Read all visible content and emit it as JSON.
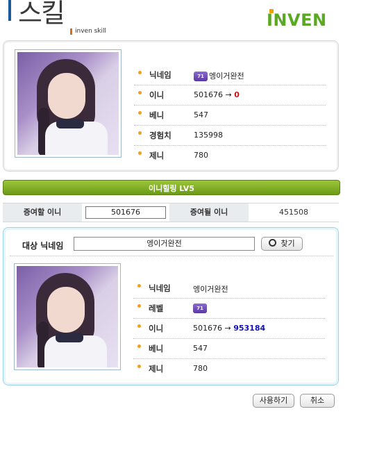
{
  "header": {
    "title": "스킬",
    "subtitle": "inven skill",
    "logo": "INVEN"
  },
  "my_profile": {
    "rows": [
      {
        "label": "닉네임",
        "value": "엥이거완전",
        "badge": "71"
      },
      {
        "label": "이니",
        "value": "501676 →",
        "value_extra": "0"
      },
      {
        "label": "베니",
        "value": "547"
      },
      {
        "label": "경험치",
        "value": "135998"
      },
      {
        "label": "제니",
        "value": "780"
      }
    ]
  },
  "skill_bar": {
    "title": "이니힐링 LV5"
  },
  "gift": {
    "give_label": "증여할 이니",
    "give_value": "501676",
    "receive_label": "증여될 이니",
    "receive_value": "451508"
  },
  "target": {
    "label": "대상 닉네임",
    "input_value": "엥이거완전",
    "search_label": "찾기",
    "rows": [
      {
        "label": "닉네임",
        "value": "엥이거완전"
      },
      {
        "label": "레벨",
        "badge": "71"
      },
      {
        "label": "이니",
        "value": "501676 →",
        "value_extra": "953184"
      },
      {
        "label": "베니",
        "value": "547"
      },
      {
        "label": "제니",
        "value": "780"
      }
    ]
  },
  "actions": {
    "use_label": "사용하기",
    "cancel_label": "취소"
  },
  "colors": {
    "accent_green": "#7aa81e",
    "brand_green": "#5aa824",
    "bullet": "#f0a020",
    "negative": "#d01010",
    "positive": "#1010c0"
  }
}
